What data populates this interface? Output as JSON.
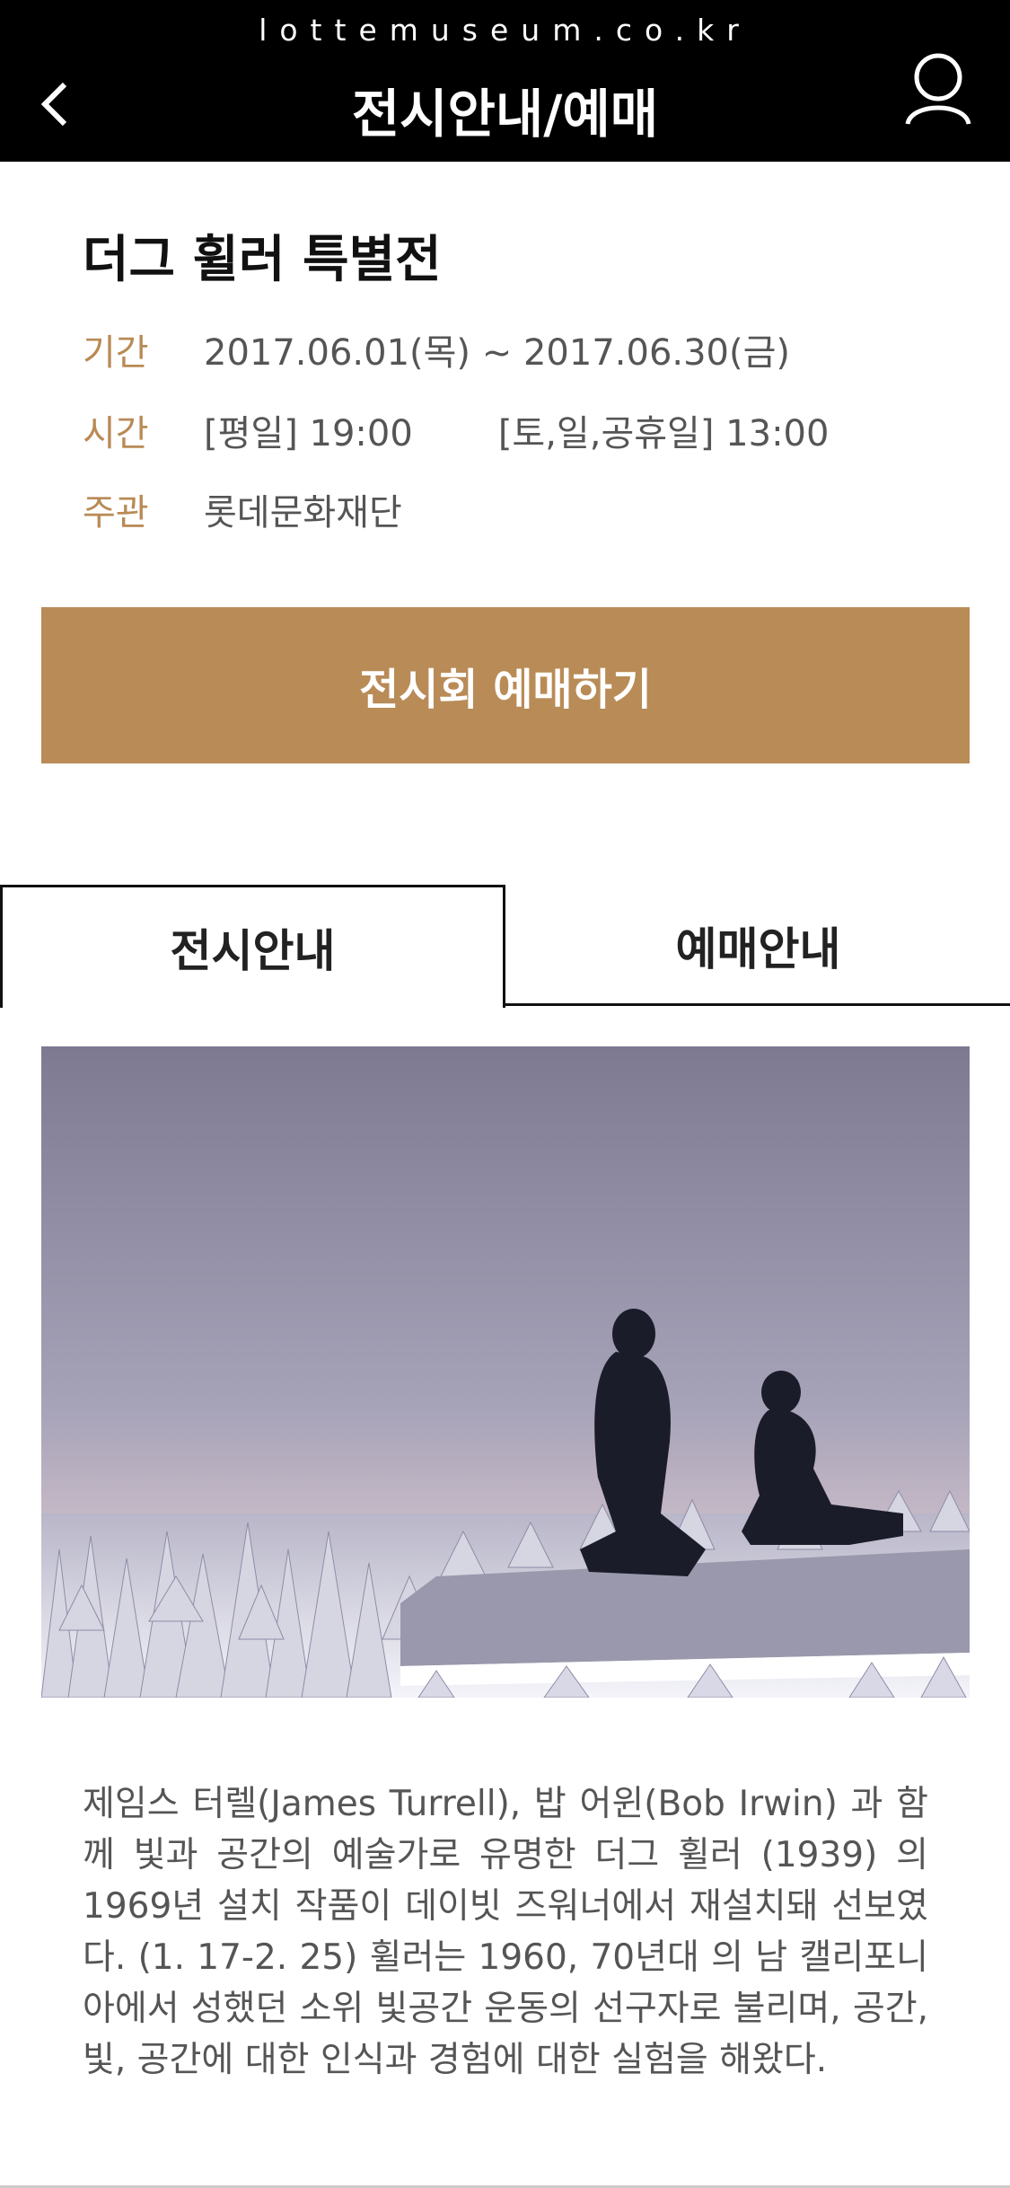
{
  "header": {
    "url": "lottemuseum.co.kr",
    "title": "전시안내/예매"
  },
  "exhibition": {
    "title": "더그 휠러 특별전",
    "period_label": "기간",
    "period_value": "2017.06.01(목) ~ 2017.06.30(금)",
    "time_label": "시간",
    "time_weekday": "[평일] 19:00",
    "time_weekend": "[토,일,공휴일] 13:00",
    "host_label": "주관",
    "host_value": "롯데문화재단"
  },
  "reserve_button": "전시회 예매하기",
  "tabs": [
    {
      "label": "전시안내"
    },
    {
      "label": "예매안내"
    }
  ],
  "description": "제임스 터렐(James Turrell), 밥 어윈(Bob Irwin) 과 함께 빛과 공간의 예술가로 유명한 더그 휠러 (1939) 의 1969년 설치 작품이 데이빗 즈워너에서 재설치돼 선보였다. (1. 17-2. 25) 휠러는 1960, 70년대 의 남 캘리포니아에서 성했던 소위 빛공간 운동의 선구자로 불리며, 공간, 빛, 공간에 대한 인식과 경험에 대한 실험을 해왔다.",
  "colors": {
    "accent": "#b98b57",
    "header_bg": "#000000"
  },
  "icons": {
    "back": "chevron-left-icon",
    "user": "user-icon"
  }
}
